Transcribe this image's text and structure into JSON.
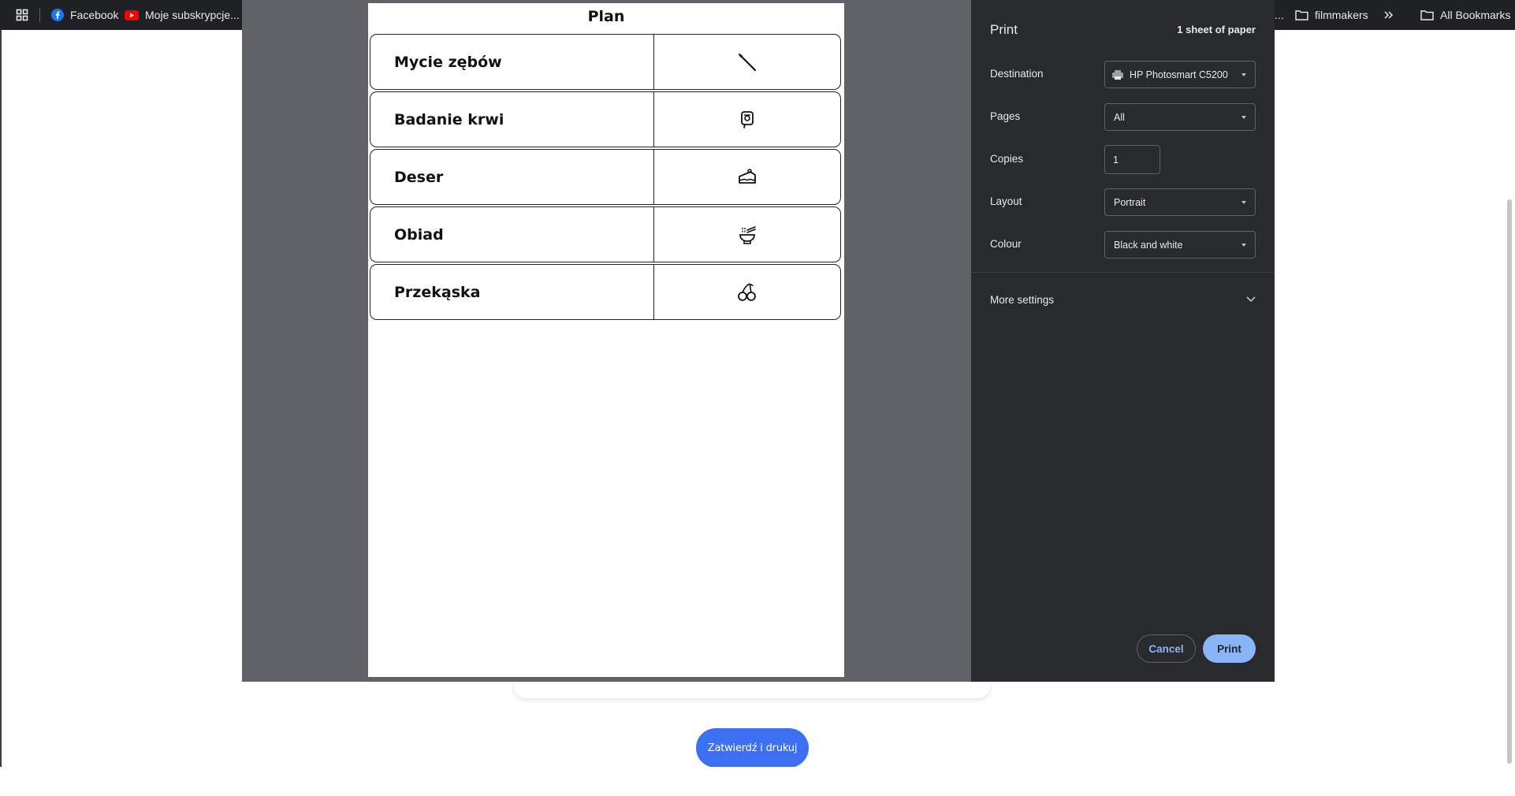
{
  "bookmarks_bar": {
    "items": [
      {
        "label": "Facebook"
      },
      {
        "label": "Moje subskrypcje..."
      },
      {
        "label": "..."
      },
      {
        "label": "filmmakers"
      },
      {
        "label": "All Bookmarks"
      }
    ],
    "overflow_icon": "double-chevron-right-icon",
    "apps_icon": "apps-grid-icon"
  },
  "page": {
    "confirm_button": "Zatwierdź i drukuj"
  },
  "print_preview": {
    "title": "Plan",
    "rows": [
      {
        "label": "Mycie zębów",
        "icon": "toothbrush-icon"
      },
      {
        "label": "Badanie krwi",
        "icon": "blood-test-icon"
      },
      {
        "label": "Deser",
        "icon": "cake-icon"
      },
      {
        "label": "Obiad",
        "icon": "bowl-with-chopsticks-icon"
      },
      {
        "label": "Przekąska",
        "icon": "cherries-icon"
      }
    ]
  },
  "print_settings": {
    "title": "Print",
    "sheets": "1 sheet of paper",
    "destination": {
      "label": "Destination",
      "value": "HP Photosmart C5200",
      "icon": "printer-icon"
    },
    "pages": {
      "label": "Pages",
      "value": "All"
    },
    "copies": {
      "label": "Copies",
      "value": "1"
    },
    "layout": {
      "label": "Layout",
      "value": "Portrait"
    },
    "colour": {
      "label": "Colour",
      "value": "Black and white"
    },
    "more_settings": "More settings",
    "cancel": "Cancel",
    "print": "Print",
    "colors": {
      "panel": "#292a2d",
      "accent": "#8ab4f8",
      "preview_bg": "#5f6368",
      "confirm": "#3d6ff2"
    }
  }
}
